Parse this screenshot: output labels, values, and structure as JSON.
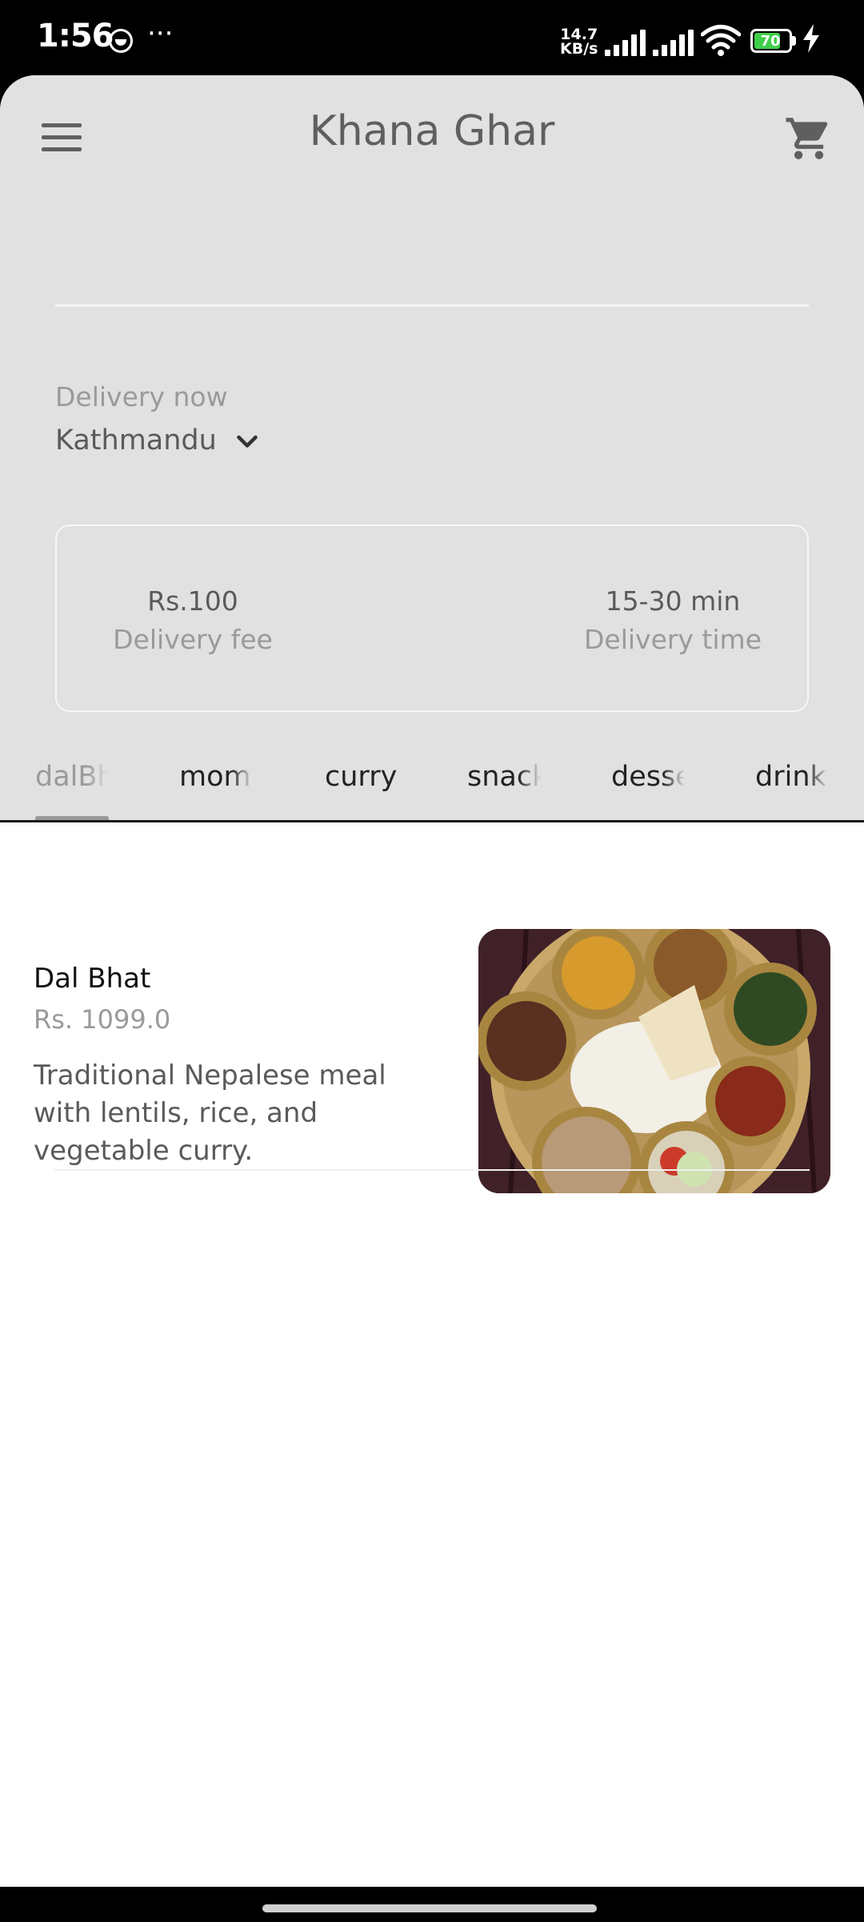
{
  "status_bar": {
    "time": "1:56",
    "more": "···",
    "speed_top": "14.7",
    "speed_bottom": "KB/s",
    "battery": "70"
  },
  "header": {
    "title": "Khana Ghar",
    "menu_icon": "hamburger-menu-icon",
    "cart_icon": "shopping-cart-icon"
  },
  "delivery": {
    "label": "Delivery now",
    "location": "Kathmandu"
  },
  "info_card": {
    "fee_value": "Rs.100",
    "fee_label": "Delivery fee",
    "time_value": "15-30 min",
    "time_label": "Delivery time"
  },
  "tabs": [
    "dalBhat",
    "momo",
    "curry",
    "snacks",
    "dessert",
    "drinks"
  ],
  "selected_tab": "dalBhat",
  "menu_items": [
    {
      "name": "Dal Bhat",
      "price": "Rs. 1099.0",
      "description": "Traditional Nepalese meal with lentils, rice, and vegetable curry."
    }
  ],
  "colors": {
    "header_bg": "#e1e1e1",
    "title": "#5f5f5f",
    "muted": "#9a9a9a",
    "battery_green": "#3fcf4a"
  }
}
